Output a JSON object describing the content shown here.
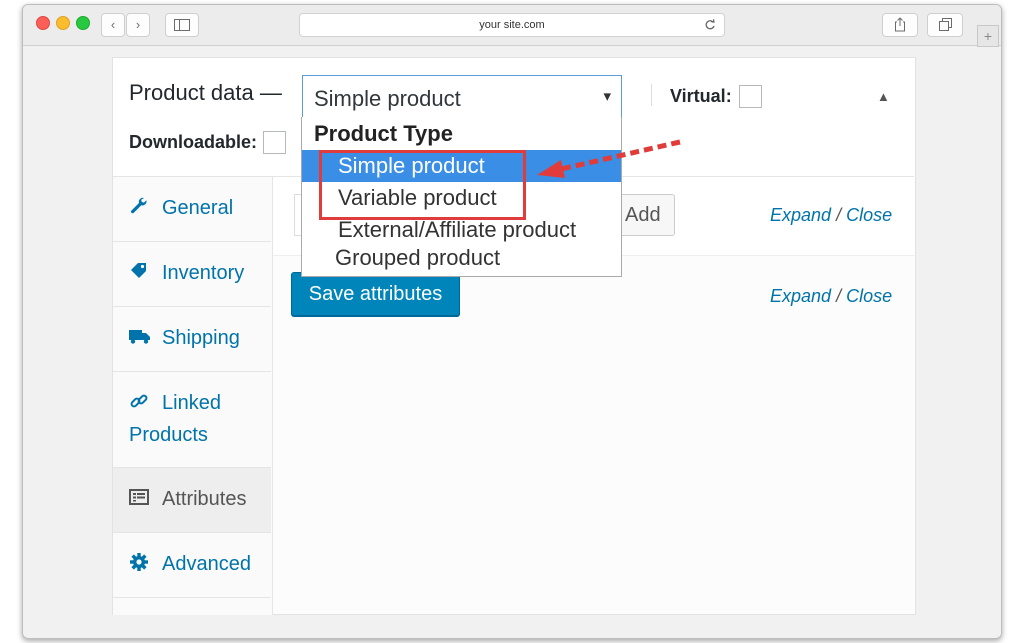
{
  "browser": {
    "url": "your site.com",
    "back_glyph": "‹",
    "forward_glyph": "›",
    "plus_glyph": "+"
  },
  "product_data": {
    "title": "Product data —",
    "product_type_value": "Simple product",
    "select_arrow_glyph": "▾",
    "virtual_label": "Virtual:",
    "downloadable_label": "Downloadable:",
    "collapse_glyph": "▲"
  },
  "dropdown": {
    "group_label": "Product Type",
    "options": [
      "Simple product",
      "Variable product",
      "External/Affiliate product",
      "Grouped product"
    ],
    "selected": "Simple product"
  },
  "tabs": [
    {
      "label": "General",
      "icon": "wrench-icon"
    },
    {
      "label": "Inventory",
      "icon": "tag-icon"
    },
    {
      "label": "Shipping",
      "icon": "truck-icon"
    },
    {
      "label": "Linked",
      "label2": "Products",
      "icon": "link-icon"
    },
    {
      "label": "Attributes",
      "icon": "list-icon",
      "active": true
    },
    {
      "label": "Advanced",
      "icon": "gear-icon"
    }
  ],
  "content": {
    "add_button": "Add",
    "expand": "Expand",
    "slash": "/",
    "close": "Close",
    "save_button": "Save attributes"
  },
  "colors": {
    "accent": "#0073aa",
    "primary_button": "#0085ba",
    "selected_option": "#3a8ee6",
    "annotation_red": "#e13c3c"
  }
}
